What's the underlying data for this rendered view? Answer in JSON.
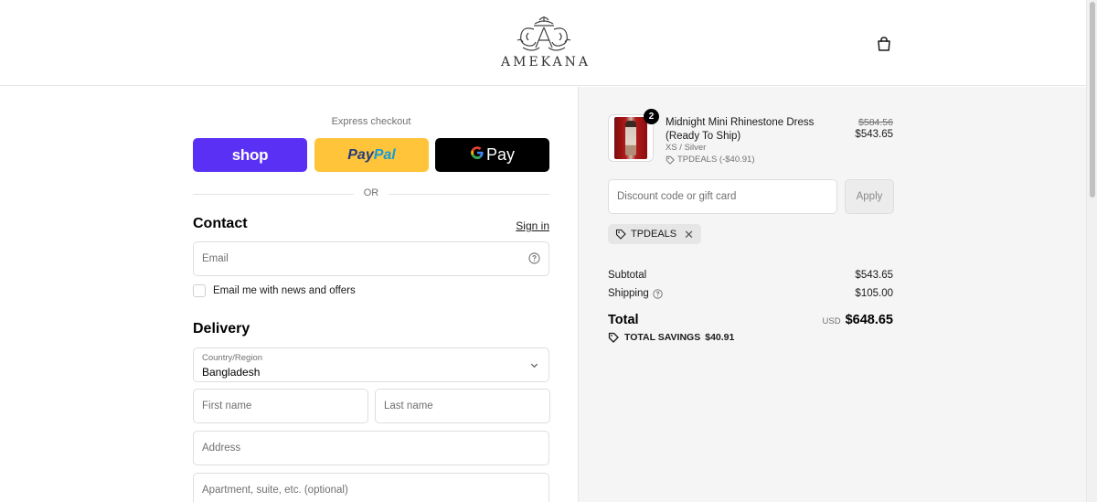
{
  "header": {
    "brand": "AMEKANA",
    "cart_icon": "shopping-bag-icon"
  },
  "checkout": {
    "express_label": "Express checkout",
    "buttons": {
      "shop": "shop",
      "paypal_a": "Pay",
      "paypal_b": "Pal",
      "gpay_g": "G",
      "gpay_text": "Pay"
    },
    "or_text": "OR",
    "contact": {
      "title": "Contact",
      "signin": "Sign in",
      "email_placeholder": "Email",
      "newsletter_label": "Email me with news and offers"
    },
    "delivery": {
      "title": "Delivery",
      "country_label": "Country/Region",
      "country_value": "Bangladesh",
      "first_name_placeholder": "First name",
      "last_name_placeholder": "Last name",
      "address_placeholder": "Address",
      "apartment_placeholder": "Apartment, suite, etc. (optional)"
    }
  },
  "summary": {
    "item": {
      "quantity": "2",
      "name": "Midnight Mini Rhinestone Dress (Ready To Ship)",
      "variant": "XS / Silver",
      "discount": "TPDEALS (-$40.91)",
      "price_original": "$584.56",
      "price_final": "$543.65"
    },
    "discount_placeholder": "Discount code or gift card",
    "apply_label": "Apply",
    "applied_code": "TPDEALS",
    "subtotal_label": "Subtotal",
    "subtotal_value": "$543.65",
    "shipping_label": "Shipping",
    "shipping_value": "$105.00",
    "total_label": "Total",
    "currency": "USD",
    "total_value": "$648.65",
    "savings_label": "TOTAL SAVINGS",
    "savings_value": "$40.91"
  },
  "colors": {
    "shop_purple": "#5a31f4",
    "paypal_yellow": "#ffc439",
    "gpay_black": "#000000",
    "summary_bg": "#f5f5f5"
  }
}
